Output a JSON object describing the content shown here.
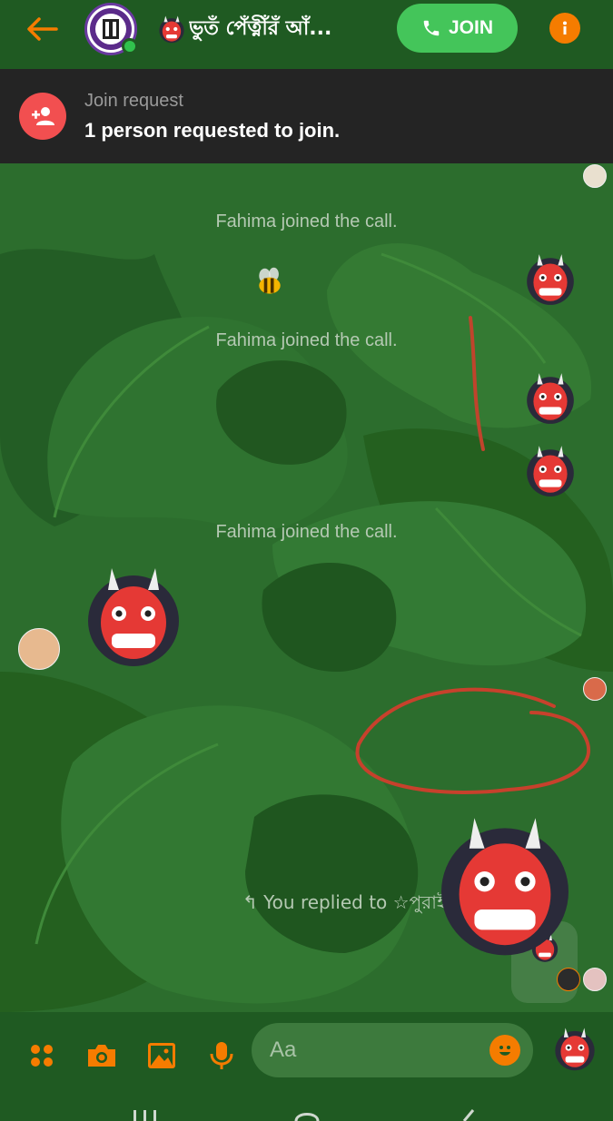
{
  "colors": {
    "accent": "#f57c00",
    "header_bg": "#1f5a22",
    "join_green": "#44c55a",
    "online_green": "#31c24d",
    "banner_bg": "#242424",
    "request_red": "#f24f50",
    "chat_bg": "#2b6c2c"
  },
  "header": {
    "title": "ভুতঁ পেঁত্নীঁরঁ আঁ...",
    "join_label": "JOIN",
    "icons": [
      "back-arrow-icon",
      "group-avatar",
      "phone-icon",
      "info-icon"
    ]
  },
  "join_request": {
    "title": "Join request",
    "text": "1 person requested to join."
  },
  "messages": {
    "system_1": "Fahima joined the call.",
    "system_2": "Fahima joined the call.",
    "system_3": "Fahima joined the call.",
    "reply_note": "You replied to ☆পুরাই জালীয়াতি☆"
  },
  "composer": {
    "placeholder": "Aa",
    "icons": [
      "apps-icon",
      "camera-icon",
      "gallery-icon",
      "microphone-icon",
      "emoji-icon",
      "ogre-sticker-send"
    ]
  }
}
